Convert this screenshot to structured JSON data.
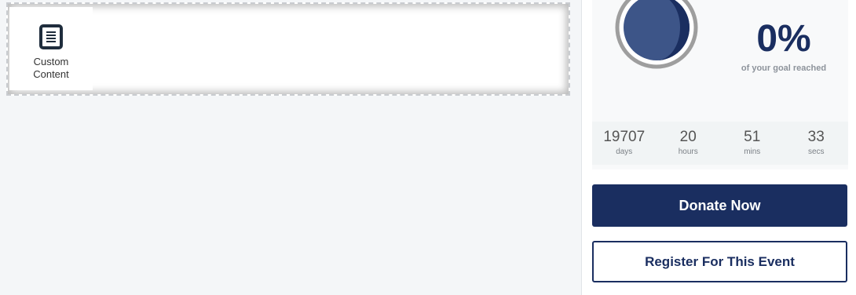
{
  "editor": {
    "widget": {
      "label": "Custom\nContent",
      "icon": "document-icon"
    }
  },
  "goal": {
    "percent_text": "0%",
    "percent_value": 0,
    "subtitle": "of your goal reached"
  },
  "countdown": [
    {
      "value": "19707",
      "unit": "days"
    },
    {
      "value": "20",
      "unit": "hours"
    },
    {
      "value": "51",
      "unit": "mins"
    },
    {
      "value": "33",
      "unit": "secs"
    }
  ],
  "actions": {
    "donate_label": "Donate Now",
    "register_label": "Register For This Event"
  },
  "colors": {
    "brand": "#1a2e60",
    "donut_fill": "#3d5588",
    "donut_ring": "#9e9e9e"
  }
}
